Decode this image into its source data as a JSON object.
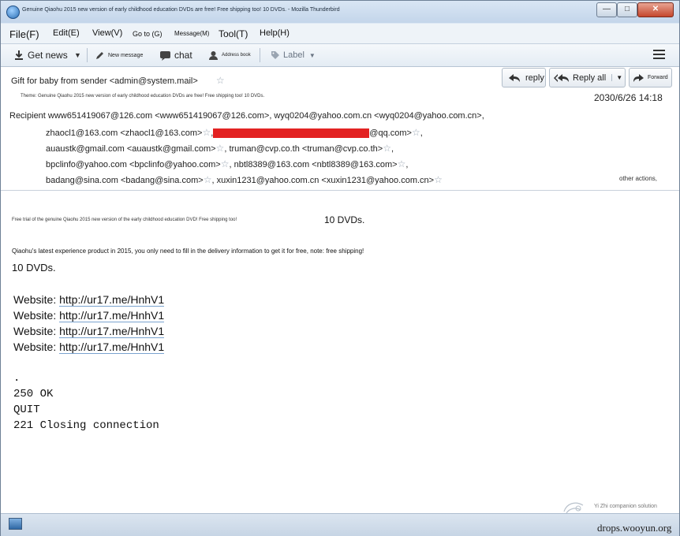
{
  "window": {
    "title": "Genuine Qiaohu 2015 new version of early childhood education DVDs are free! Free shipping too! 10 DVDs. - Mozilla Thunderbird",
    "controls": {
      "minimize": "—",
      "maximize": "□",
      "close": "✕"
    }
  },
  "menu": [
    {
      "label": "File(F)"
    },
    {
      "label": "Edit(E)"
    },
    {
      "label": "View(V)"
    },
    {
      "label": "Go to (G)"
    },
    {
      "label": "Message(M)"
    },
    {
      "label": "Tool(T)"
    },
    {
      "label": "Help(H)"
    }
  ],
  "toolbar": {
    "get_news": "Get news",
    "new_message": "New message",
    "chat": "chat",
    "address_book": "Address book",
    "label": "Label"
  },
  "header": {
    "from": "Gift for baby from sender <admin@system.mail>",
    "subject": "Theme: Genuine Qiaohu 2015 new version of early childhood education DVDs are free! Free shipping too! 10 DVDs.",
    "date": "2030/6/26 14:18",
    "buttons": {
      "reply": "reply",
      "reply_all": "Reply all",
      "forward": "Forward"
    },
    "recipient_label": "Recipient",
    "recipient_line1": "www651419067@126.com <www651419067@126.com>, wyq0204@yahoo.com.cn <wyq0204@yahoo.com.cn>,",
    "recipient_line2_a": "zhaocl1@163.com <zhaocl1@163.com>",
    "recipient_line2_b": "@qq.com>",
    "recipient_line3_a": "auaustk@gmail.com <auaustk@gmail.com>",
    "recipient_line3_b": "truman@cvp.co.th <truman@cvp.co.th>",
    "recipient_line4_a": "bpclinfo@yahoo.com <bpclinfo@yahoo.com>",
    "recipient_line4_b": "nbtl8389@163.com <nbtl8389@163.com>",
    "recipient_line5_a": "badang@sina.com <badang@sina.com>",
    "recipient_line5_b": "xuxin1231@yahoo.com.cn <xuxin1231@yahoo.com.cn>",
    "other_actions": "other actions,"
  },
  "body": {
    "intro_small": "Free trial of the genuine Qiaohu 2015 new version of the early childhood education DVD! Free shipping too!",
    "intro_dvds": "10 DVDs.",
    "description": "Qiaohu's latest experience product in 2015, you only need to fill in the delivery information to get it for free, note: free shipping!",
    "dvds": "10 DVDs.",
    "website_label": "Website:",
    "url": "http://ur17.me/HnhV1",
    "smtp_dot": ".",
    "smtp_ok": "250 OK",
    "smtp_quit": "QUIT",
    "smtp_close": "221 Closing connection"
  },
  "watermark": {
    "logo_text": "Yi Zhi companion solution",
    "url": "drops.wooyun.org"
  },
  "icons": {
    "get_news": "download-icon",
    "new_message": "pencil-icon",
    "chat": "speech-bubble-icon",
    "address_book": "contact-icon",
    "label": "tag-icon",
    "menu": "hamburger-icon",
    "star": "star-icon"
  }
}
